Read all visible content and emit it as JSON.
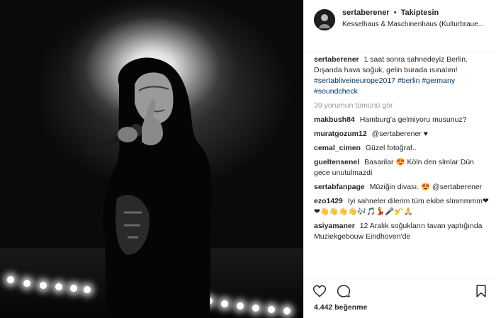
{
  "post": {
    "username": "sertaberener",
    "separator": "•",
    "follow_label": "Takiptesin",
    "location": "Kesselhaus & Maschinenhaus (Kulturbraue..."
  },
  "caption": {
    "username": "sertaberener",
    "text": "1 saat sonra sahnedeyiz Berlin. Dışarıda hava soğuk, gelin burada ısınalım!",
    "hashtags": [
      "#sertabliveineurope2017",
      "#berlin",
      "#germany",
      "#soundcheck"
    ]
  },
  "view_all_comments": "39 yorumun tümünü gör",
  "comments": [
    {
      "username": "makbush84",
      "text": "Hamburg'a gelmiyoru musunuz?"
    },
    {
      "username": "muratgozum12",
      "text": "@sertaberener ♥"
    },
    {
      "username": "cemal_cimen",
      "text": "Güzel fotoğraf.."
    },
    {
      "username": "gueltensenel",
      "text": "Basarilar 😍 Köln den slmlar Dün gece unutulmazdi"
    },
    {
      "username": "sertabfanpage",
      "text": "Müziğin divası. 😍 @sertaberener"
    },
    {
      "username": "ezo1429",
      "text": "Iyi sahneler dilerim tüm ekibe slmmmmm❤❤👋👋👋👋🎶🎵💃🎤🎷🙏"
    },
    {
      "username": "asiyamaner",
      "text": "12 Aralık soğukların tavan yaptığında Muziekgebouw Eindhoven'de"
    }
  ],
  "likes": "4.442 beğenme",
  "icons": {
    "avatar": "avatar",
    "like": "heart-icon",
    "comment": "comment-icon",
    "share": "share-icon",
    "save": "bookmark-icon"
  },
  "colors": {
    "link": "#003569",
    "muted": "#999999",
    "text": "#262626"
  }
}
